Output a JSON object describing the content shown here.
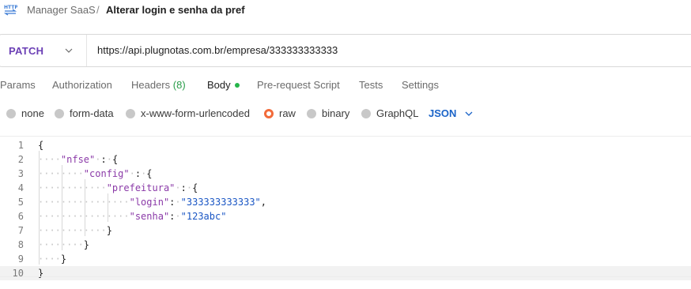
{
  "breadcrumb": {
    "icon": "http-request-icon",
    "parent": "Manager SaaS",
    "separator": "/",
    "current": "Alterar login e senha da pref"
  },
  "request": {
    "method": "PATCH",
    "url": "https://api.plugnotas.com.br/empresa/333333333333"
  },
  "tabs": [
    {
      "label": "Params"
    },
    {
      "label": "Authorization"
    },
    {
      "label": "Headers",
      "count": "(8)"
    },
    {
      "label": "Body",
      "active": true,
      "dot_color": "#26b54a"
    },
    {
      "label": "Pre-request Script"
    },
    {
      "label": "Tests"
    },
    {
      "label": "Settings"
    }
  ],
  "body_types": [
    {
      "label": "none"
    },
    {
      "label": "form-data"
    },
    {
      "label": "x-www-form-urlencoded"
    },
    {
      "label": "raw",
      "selected": true
    },
    {
      "label": "binary"
    },
    {
      "label": "GraphQL"
    }
  ],
  "language": "JSON",
  "colors": {
    "method": "#6b3fb5",
    "key": "#8b3aa8",
    "string": "#1a56c4",
    "radio_selected": "#f26b3a",
    "language": "#1b64c8"
  },
  "editor": {
    "line_numbers": [
      "1",
      "2",
      "3",
      "4",
      "5",
      "6",
      "7",
      "8",
      "9",
      "10"
    ],
    "lines": [
      {
        "ws": "",
        "parts": [
          [
            "p",
            "{"
          ]
        ]
      },
      {
        "ws": "····",
        "parts": [
          [
            "k",
            "\"nfse\""
          ],
          [
            "ws",
            "·"
          ],
          [
            "p",
            ":"
          ],
          [
            "ws",
            "·"
          ],
          [
            "p",
            "{"
          ]
        ]
      },
      {
        "ws": "········",
        "parts": [
          [
            "k",
            "\"config\""
          ],
          [
            "ws",
            "·"
          ],
          [
            "p",
            ":"
          ],
          [
            "ws",
            "·"
          ],
          [
            "p",
            "{"
          ]
        ]
      },
      {
        "ws": "············",
        "parts": [
          [
            "k",
            "\"prefeitura\""
          ],
          [
            "ws",
            "·"
          ],
          [
            "p",
            ":"
          ],
          [
            "ws",
            "·"
          ],
          [
            "p",
            "{"
          ]
        ]
      },
      {
        "ws": "················",
        "parts": [
          [
            "k",
            "\"login\""
          ],
          [
            "p",
            ":"
          ],
          [
            "ws",
            "·"
          ],
          [
            "s",
            "\"333333333333\""
          ],
          [
            "p",
            ","
          ]
        ]
      },
      {
        "ws": "················",
        "parts": [
          [
            "k",
            "\"senha\""
          ],
          [
            "p",
            ":"
          ],
          [
            "ws",
            "·"
          ],
          [
            "s",
            "\"123abc\""
          ]
        ]
      },
      {
        "ws": "············",
        "parts": [
          [
            "p",
            "}"
          ]
        ]
      },
      {
        "ws": "········",
        "parts": [
          [
            "p",
            "}"
          ]
        ]
      },
      {
        "ws": "····",
        "parts": [
          [
            "p",
            "}"
          ]
        ]
      },
      {
        "ws": "",
        "parts": [
          [
            "p",
            "}"
          ]
        ]
      }
    ]
  }
}
